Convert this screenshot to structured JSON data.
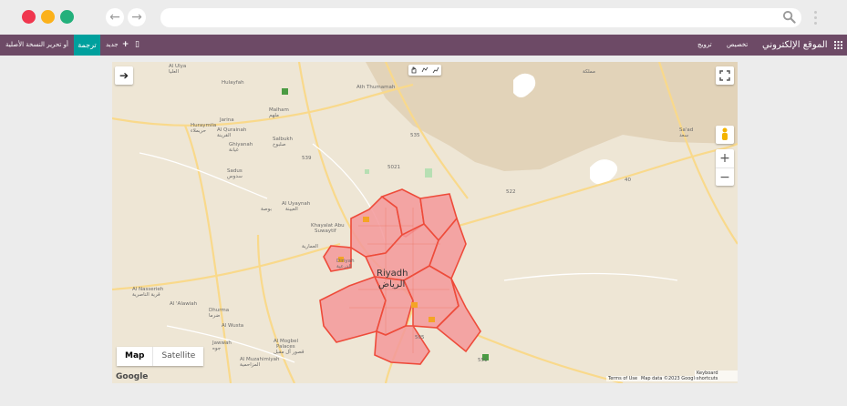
{
  "browser": {
    "dots": [
      "#f0364e",
      "#fbb11b",
      "#23b07b"
    ],
    "back_icon": "←",
    "forward_icon": "→"
  },
  "topbar": {
    "apps_icon": "apps-grid-icon",
    "site_title": "الموقع الإلكتروني",
    "menu_customize": "تخصيص",
    "menu_promote": "ترويج",
    "mobile_icon": "▯",
    "new_label": "جديد",
    "new_icon": "+",
    "translate_label": "ترجمة",
    "edit_original_label": "أو تحرير النسخة الأصلية"
  },
  "map": {
    "map_type_map": "Map",
    "map_type_satellite": "Satellite",
    "google_logo": "Google",
    "attribution_terms": "Terms of Use",
    "attribution_data": "Map data ©2023 Google",
    "attribution_keys": "Keyboard shortcuts",
    "zoom_in": "+",
    "zoom_out": "−",
    "arrow_icon": "➔",
    "city_en": "Riyadh",
    "city_ar": "الرياض",
    "places": {
      "al_ulya": "Al Ulya",
      "al_ulya_ar": "العليا",
      "hulayfah": "Hulayfah",
      "huraymila": "Huraymila",
      "huraymila_ar": "حريملاء",
      "jarina": "Jarina",
      "al_qurainah": "Al Qurainah",
      "al_qurainah_ar": "القرينة",
      "ghiyanah": "Ghiyanah",
      "ghiyanah_ar": "غيانة",
      "malham": "Malham",
      "malham_ar": "ملهم",
      "salbukh": "Salbukh",
      "salbukh_ar": "صلبوخ",
      "sadus": "Sadus",
      "sadus_ar": "سدوس",
      "ath_thumamah": "Ath Thumamah",
      "al_uyaynah": "Al Uyaynah",
      "al_uyaynah_ar": "العيينة",
      "bausa": "بوصة",
      "khayalat_1": "Khayalat Abu",
      "khayalat_2": "Suwaytif",
      "al_ammariyah_ar": "العمارية",
      "diriyah": "Diriyah",
      "diriyah_ar": "الدرعية",
      "al_nasserieh": "Al Nasserieh",
      "al_nasserieh_ar": "قرية الناصرية",
      "al_alawiah": "Al 'Alawiah",
      "dhurma": "Dhurma",
      "dhurma_ar": "ضرما",
      "al_wusta": "Al Wusta",
      "jawwah": "Jawwah",
      "jawwah_ar": "جوه",
      "al_mogbel_1": "Al Mogbel",
      "al_mogbel_2": "Palaces",
      "al_mogbel_ar": "قصور آل مقبل",
      "al_muzahimiyah": "Al Muzahimiyah",
      "al_muzahimiyah_ar": "المزاحمية",
      "sad": "Sa'ad",
      "sad_ar": "سعد",
      "al_mamlaka": "مملكة",
      "road_535": "535",
      "road_505": "505",
      "road_522": "522",
      "road_539": "539",
      "road_5021": "5021",
      "road_551": "551",
      "road_40": "40"
    }
  }
}
